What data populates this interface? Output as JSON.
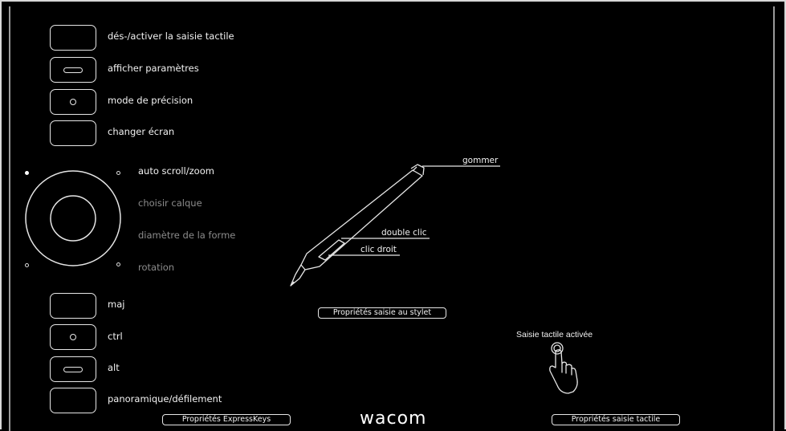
{
  "expresskeys_top": [
    {
      "label": "dés-/activer la saisie tactile",
      "icon": "none"
    },
    {
      "label": "afficher paramètres",
      "icon": "bar-icon"
    },
    {
      "label": "mode de précision",
      "icon": "dot-icon"
    },
    {
      "label": "changer écran",
      "icon": "none"
    }
  ],
  "touch_ring": {
    "items": [
      {
        "label": "auto scroll/zoom",
        "active": true
      },
      {
        "label": "choisir calque",
        "active": false
      },
      {
        "label": "diamètre de la forme",
        "active": false
      },
      {
        "label": "rotation",
        "active": false
      }
    ]
  },
  "expresskeys_bottom": [
    {
      "label": "maj",
      "icon": "none"
    },
    {
      "label": "ctrl",
      "icon": "dot-icon"
    },
    {
      "label": "alt",
      "icon": "bar-icon"
    },
    {
      "label": "panoramique/défilement",
      "icon": "none"
    }
  ],
  "pen": {
    "eraser_label": "gommer",
    "upper_button_label": "double clic",
    "lower_button_label": "clic droit"
  },
  "buttons": {
    "pen_properties": "Propriétés saisie au stylet",
    "expresskeys_properties": "Propriétés ExpressKeys",
    "touch_properties": "Propriétés saisie tactile"
  },
  "touch": {
    "status": "Saisie tactile activée",
    "icon": "touch-hand-icon"
  },
  "logo": "wacom",
  "colors": {
    "background": "#000000",
    "text": "#f2f2f2",
    "dim_text": "#8c8c8c",
    "outline": "#e6e6e6"
  }
}
